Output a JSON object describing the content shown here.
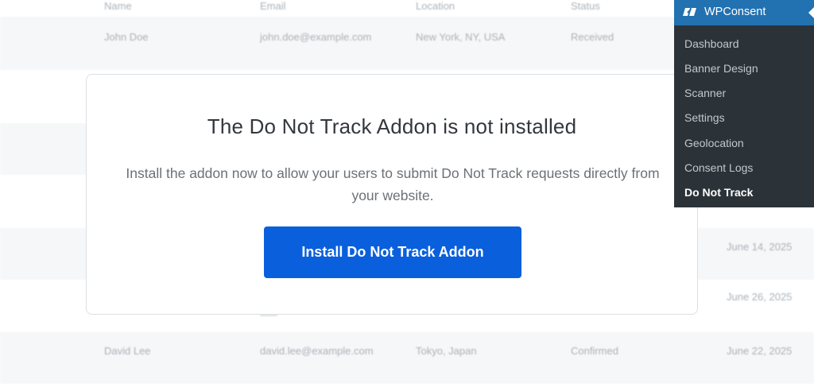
{
  "table": {
    "headers": [
      "Name",
      "Email",
      "Location",
      "Status"
    ],
    "rows": [
      {
        "name": "John Doe",
        "email": "john.doe@example.com",
        "location": "New York, NY, USA",
        "status": "Received",
        "date": ""
      },
      {
        "name": "",
        "email": "",
        "location": "",
        "status": "",
        "date": "June 14, 2025"
      },
      {
        "name": "",
        "email": "",
        "location": "",
        "status": "",
        "date": "June 26, 2025"
      },
      {
        "name": "David Lee",
        "email": "david.lee@example.com",
        "location": "Tokyo, Japan",
        "status": "Confirmed",
        "date": "June 22, 2025"
      }
    ]
  },
  "modal": {
    "title": "The Do Not Track Addon is not installed",
    "description": "Install the addon now to allow your users to submit Do Not Track requests directly from your website.",
    "button_label": "Install Do Not Track Addon"
  },
  "admin_menu": {
    "title": "WPConsent",
    "items": [
      {
        "label": "Dashboard"
      },
      {
        "label": "Banner Design"
      },
      {
        "label": "Scanner"
      },
      {
        "label": "Settings"
      },
      {
        "label": "Geolocation"
      },
      {
        "label": "Consent Logs"
      },
      {
        "label": "Do Not Track"
      }
    ],
    "current_item": "Do Not Track"
  },
  "colors": {
    "primary_button": "#0a5fdc",
    "admin_bar_accent": "#2271b1",
    "admin_menu_bg": "#2c3338"
  }
}
